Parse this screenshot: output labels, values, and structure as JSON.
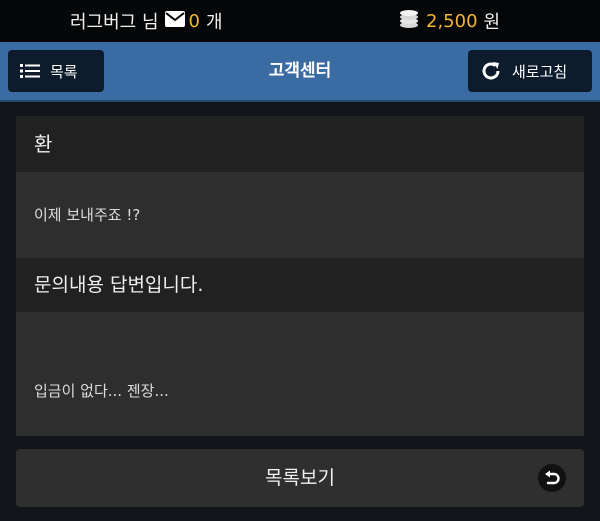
{
  "topbar": {
    "user_name": "러그버그 님",
    "mail_icon": "envelope-icon",
    "message_count": "0",
    "message_unit": "개",
    "coin_icon": "coins-icon",
    "money_amount": "2,500",
    "money_unit": "원"
  },
  "header": {
    "list_label": "목록",
    "list_icon": "list-icon",
    "title": "고객센터",
    "refresh_label": "새로고침",
    "refresh_icon": "refresh-icon"
  },
  "inquiry": {
    "title": "환",
    "body": "이제 보내주죠 !?"
  },
  "answer": {
    "title": "문의내용 답변입니다.",
    "body": "입금이 없다... 젠장..."
  },
  "footer": {
    "back_label": "목록보기",
    "back_icon": "undo-icon"
  },
  "colors": {
    "accent_gold": "#f2b632",
    "header_blue": "#3a6ca3",
    "button_navy": "#0d1b2c"
  }
}
